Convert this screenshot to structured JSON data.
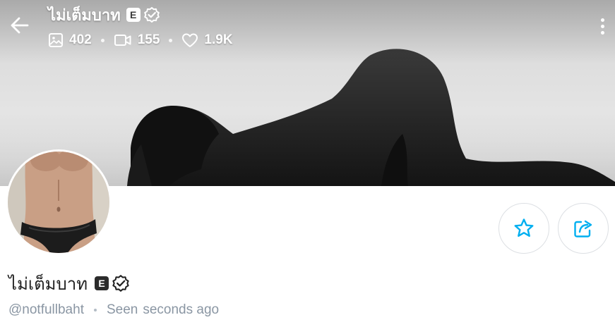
{
  "header": {
    "title": "ไม่เต็มบาท",
    "explicit_badge": "E",
    "stats": {
      "photos": "402",
      "videos": "155",
      "likes": "1.9K"
    }
  },
  "profile": {
    "display_name": "ไม่เต็มบาท",
    "explicit_badge": "E",
    "username": "@notfullbaht",
    "seen_label": "Seen",
    "seen_value": "seconds ago"
  },
  "colors": {
    "accent": "#00aff0",
    "muted_text": "#8a96a3",
    "name_text": "#222222",
    "button_border": "#dcdfe3"
  },
  "icons": {
    "back": "arrow-left-icon",
    "photos": "image-icon",
    "videos": "video-camera-icon",
    "likes": "heart-icon",
    "verified": "verified-badge-icon",
    "more": "vertical-dots-icon",
    "favorite": "star-icon",
    "share": "share-icon"
  }
}
